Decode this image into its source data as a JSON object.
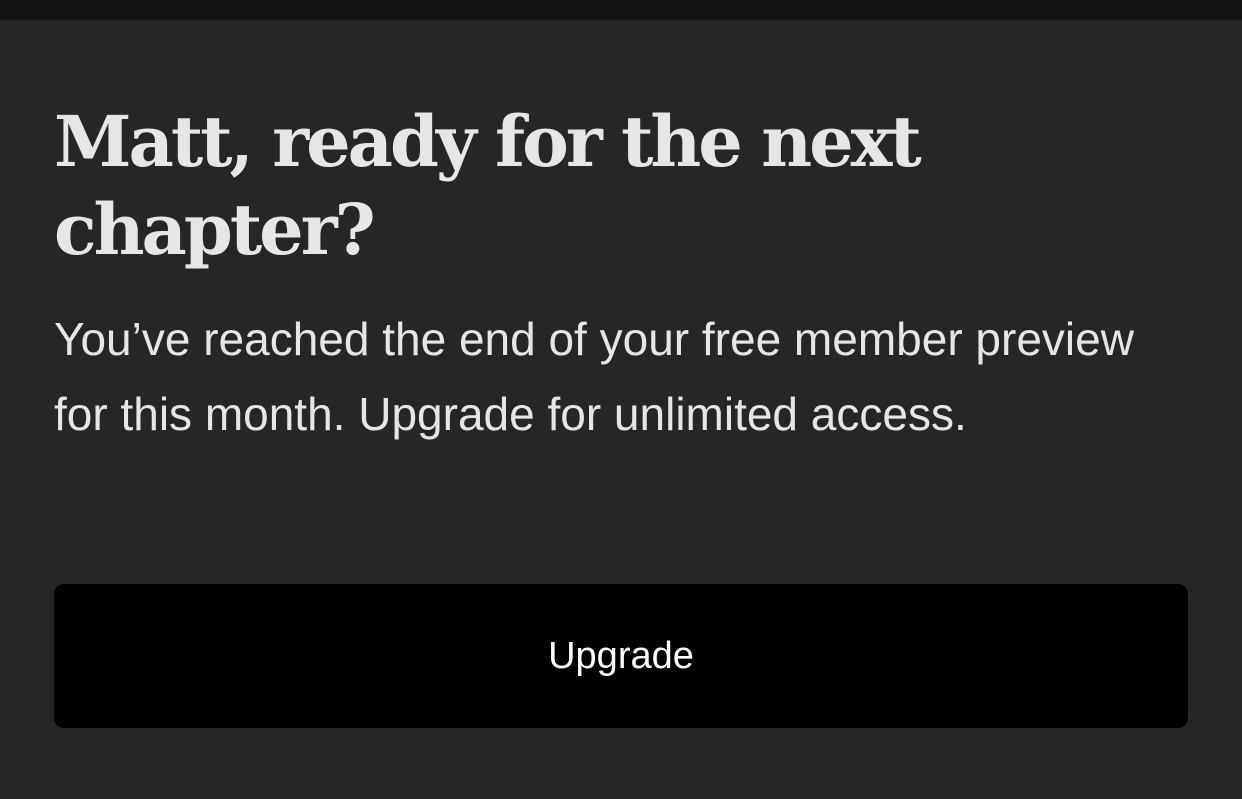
{
  "paywall": {
    "headline": "Matt, ready for the next chapter?",
    "body": "You’ve reached the end of your free member preview for this month. Upgrade for unlimited access.",
    "upgrade_label": "Upgrade"
  },
  "colors": {
    "background": "#262626",
    "top_strip": "#141414",
    "text": "#e6e6e6",
    "button_background": "#000000",
    "button_text": "#ffffff"
  }
}
